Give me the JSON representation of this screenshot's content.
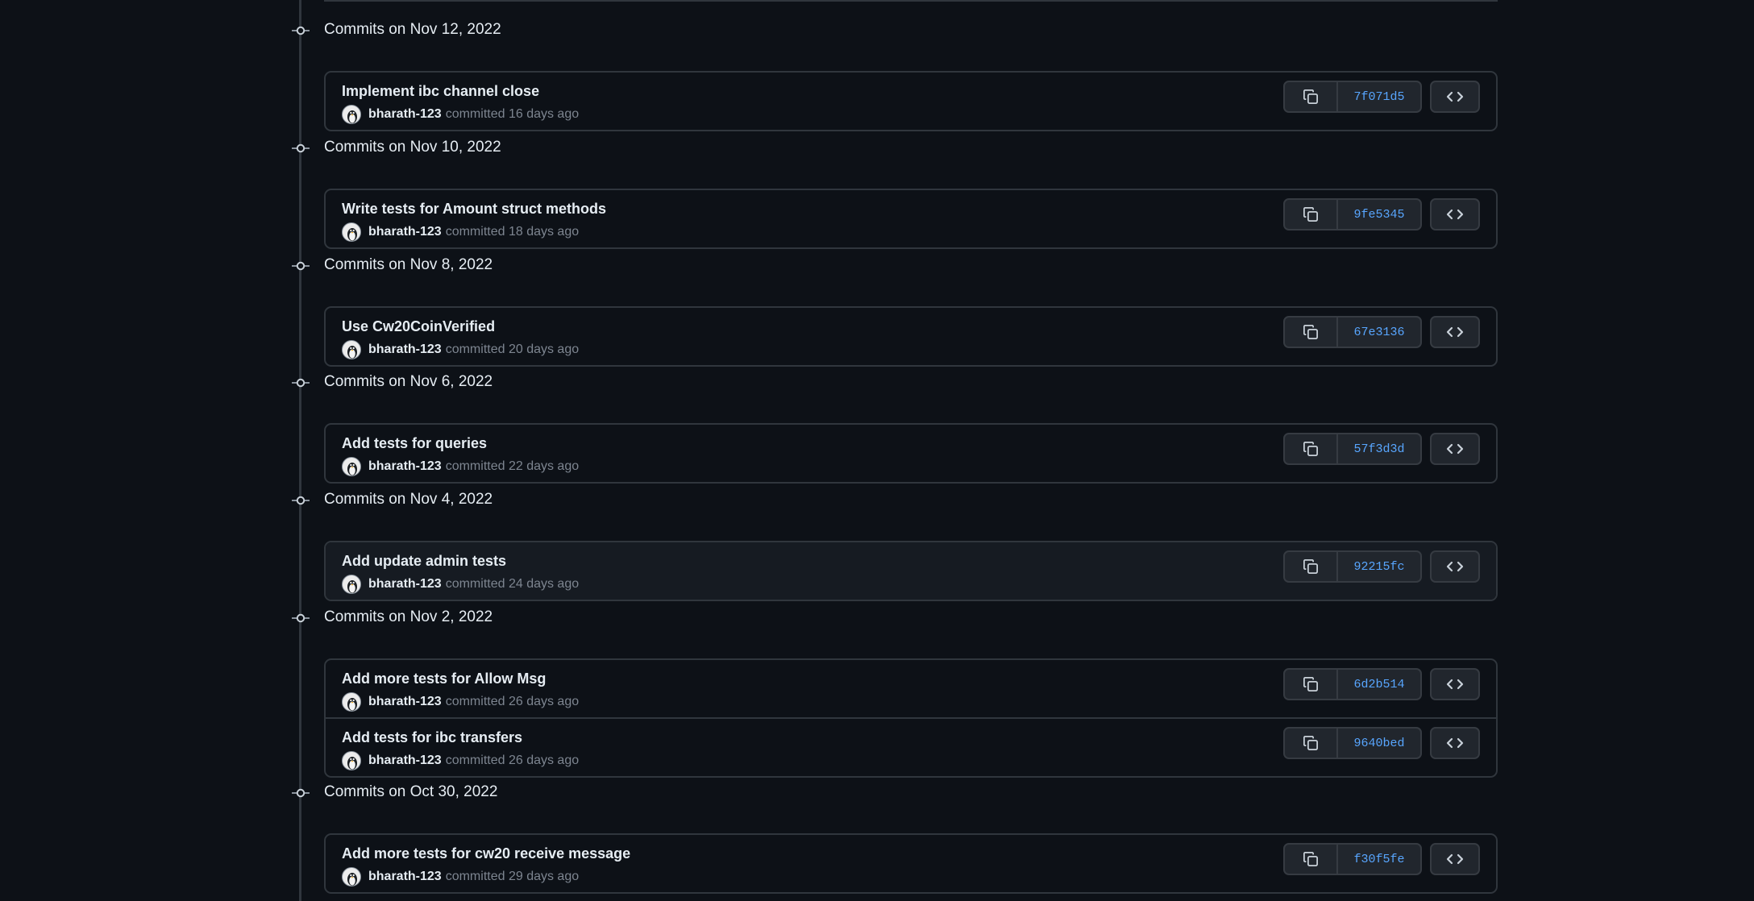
{
  "colors": {
    "background": "#0d1117",
    "sha_link": "#58a6ff",
    "muted_text": "#7d8590",
    "border": "#30363d"
  },
  "icons": {
    "timeline": "git-commit-icon",
    "copy": "copy-icon",
    "browse": "code-icon",
    "avatar": "penguin-avatar-icon"
  },
  "groups": [
    {
      "title": "Commits on Nov 12, 2022",
      "commits": [
        {
          "message": "Implement ibc channel close",
          "author": "bharath-123",
          "time": "committed 16 days ago",
          "sha": "7f071d5"
        }
      ]
    },
    {
      "title": "Commits on Nov 10, 2022",
      "commits": [
        {
          "message": "Write tests for Amount struct methods",
          "author": "bharath-123",
          "time": "committed 18 days ago",
          "sha": "9fe5345"
        }
      ]
    },
    {
      "title": "Commits on Nov 8, 2022",
      "commits": [
        {
          "message": "Use Cw20CoinVerified",
          "author": "bharath-123",
          "time": "committed 20 days ago",
          "sha": "67e3136"
        }
      ]
    },
    {
      "title": "Commits on Nov 6, 2022",
      "commits": [
        {
          "message": "Add tests for queries",
          "author": "bharath-123",
          "time": "committed 22 days ago",
          "sha": "57f3d3d"
        }
      ]
    },
    {
      "title": "Commits on Nov 4, 2022",
      "commits": [
        {
          "message": "Add update admin tests",
          "author": "bharath-123",
          "time": "committed 24 days ago",
          "sha": "92215fc",
          "highlighted": true
        }
      ]
    },
    {
      "title": "Commits on Nov 2, 2022",
      "commits": [
        {
          "message": "Add more tests for Allow Msg",
          "author": "bharath-123",
          "time": "committed 26 days ago",
          "sha": "6d2b514"
        },
        {
          "message": "Add tests for ibc transfers",
          "author": "bharath-123",
          "time": "committed 26 days ago",
          "sha": "9640bed"
        }
      ]
    },
    {
      "title": "Commits on Oct 30, 2022",
      "commits": [
        {
          "message": "Add more tests for cw20 receive message",
          "author": "bharath-123",
          "time": "committed 29 days ago",
          "sha": "f30f5fe"
        }
      ]
    }
  ]
}
